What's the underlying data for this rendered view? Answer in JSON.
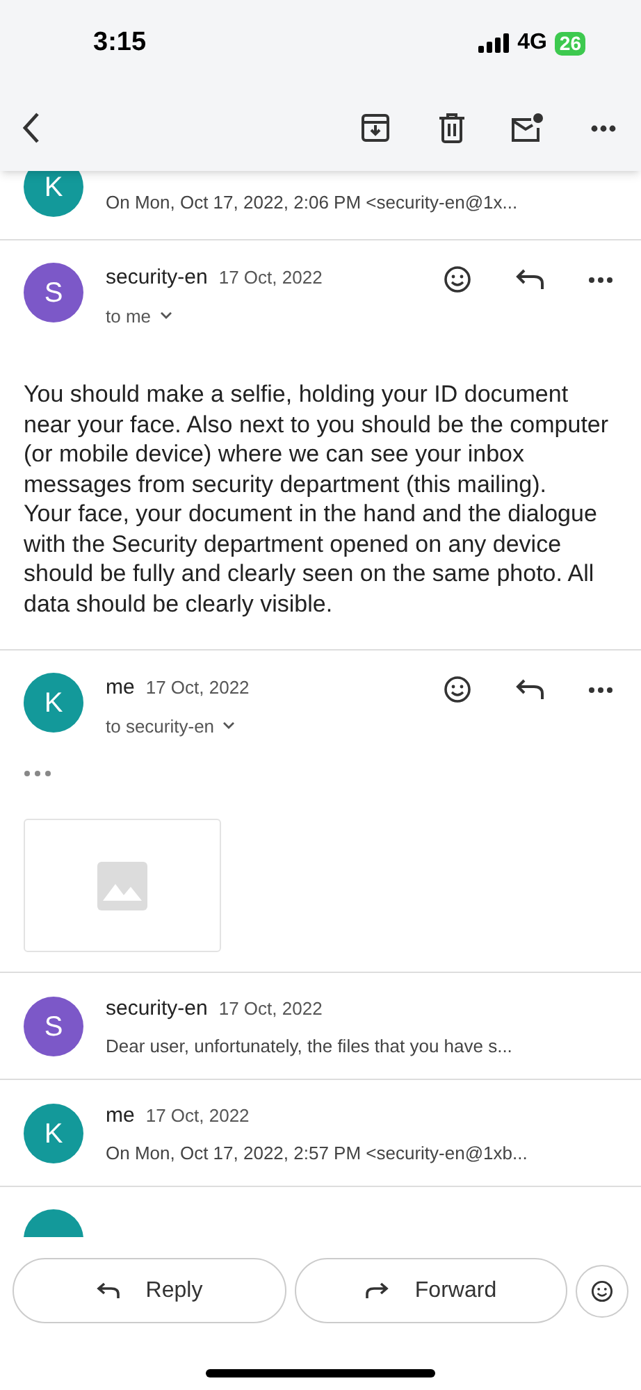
{
  "status_bar": {
    "time": "3:15",
    "network": "4G",
    "battery": "26"
  },
  "messages": [
    {
      "kind": "partial",
      "snippet": "On Mon, Oct 17, 2022, 2:06 PM <security-en@1x...",
      "avatar": "K",
      "color": "#13999a"
    },
    {
      "kind": "expanded",
      "sender": "security-en",
      "date": "17 Oct, 2022",
      "recipient": "to me",
      "avatar": "S",
      "color": "#7c58c8",
      "body": [
        "You should make a selfie, holding your ID document near your face. Also next to you should be the computer (or mobile device) where we can see your inbox messages from security department (this mailing).",
        "Your face, your document in the hand and the dialogue with the Security department opened on any device should be fully and clearly seen on the same photo. All data should be clearly visible."
      ]
    },
    {
      "kind": "expanded",
      "sender": "me",
      "date": "17 Oct, 2022",
      "recipient": "to security-en",
      "avatar": "K",
      "color": "#13999a",
      "trimmed": true,
      "attachment": true
    },
    {
      "kind": "collapsed",
      "sender": "security-en",
      "date": "17 Oct, 2022",
      "snippet": "Dear user, unfortunately, the files that you have s...",
      "avatar": "S",
      "color": "#7c58c8"
    },
    {
      "kind": "collapsed",
      "sender": "me",
      "date": "17 Oct, 2022",
      "snippet": "On Mon, Oct 17, 2022, 2:57 PM <security-en@1xb...",
      "avatar": "K",
      "color": "#13999a"
    },
    {
      "kind": "hidden",
      "color": "#13999a"
    }
  ],
  "actions": [
    "Reply",
    "Forward"
  ]
}
